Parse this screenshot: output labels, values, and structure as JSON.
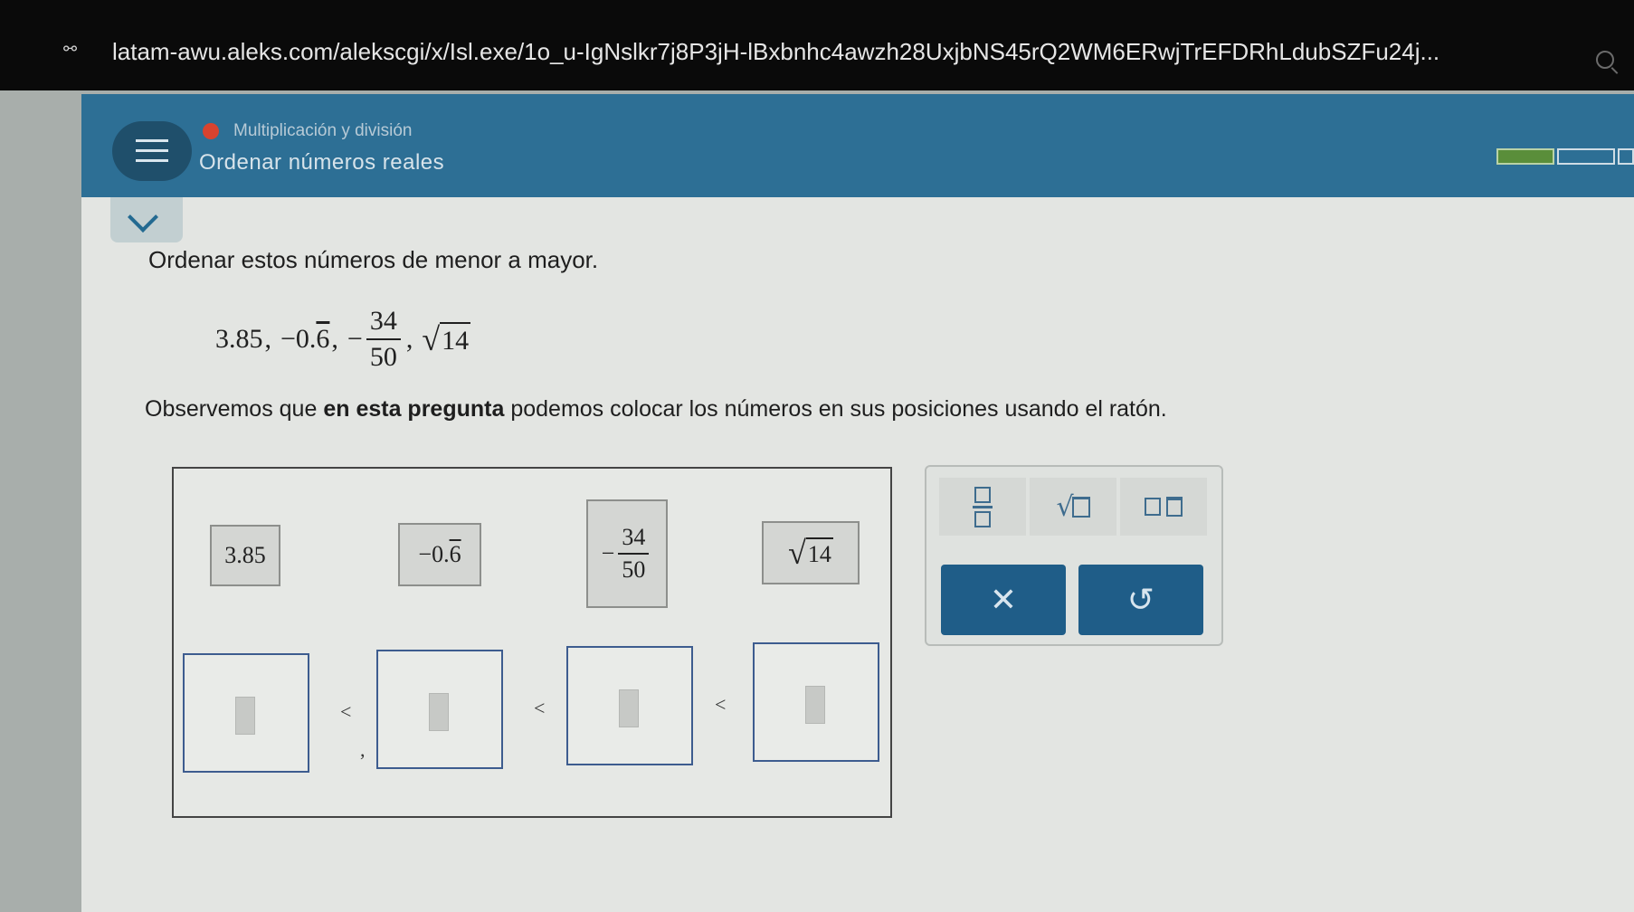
{
  "browser": {
    "site_icon": "⚯",
    "url": "latam-awu.aleks.com/alekscgi/x/Isl.exe/1o_u-IgNslkr7j8P3jH-lBxbnhc4awzh28UxjbNS45rQ2WM6ERwjTrEFDRhLdubSZFu24j..."
  },
  "header": {
    "topic": "Multiplicación y división",
    "subtopic": "Ordenar números reales",
    "progress": {
      "filled_segments": 1,
      "total_segments": 3
    }
  },
  "question": {
    "instruction": "Ordenar estos números de menor a mayor.",
    "numbers": {
      "n1": "3.85",
      "sep": ",",
      "n2_int": "−0.",
      "n2_rep": "6",
      "n3_sign": "−",
      "n3_num": "34",
      "n3_den": "50",
      "n4_sqrt": "√",
      "n4_rad": "14"
    },
    "note_pre": "Observemos que ",
    "note_bold": "en esta pregunta",
    "note_post": " podemos colocar los números en sus posiciones usando el ratón."
  },
  "tiles": {
    "t1": "3.85",
    "t2_int": "−0.",
    "t2_rep": "6",
    "t3_sign": "−",
    "t3_num": "34",
    "t3_den": "50",
    "t4_sqrt": "√",
    "t4_rad": "14"
  },
  "slots": {
    "lt": "<",
    "comma": ","
  },
  "keypad": {
    "clear": "✕",
    "undo": "↺"
  }
}
